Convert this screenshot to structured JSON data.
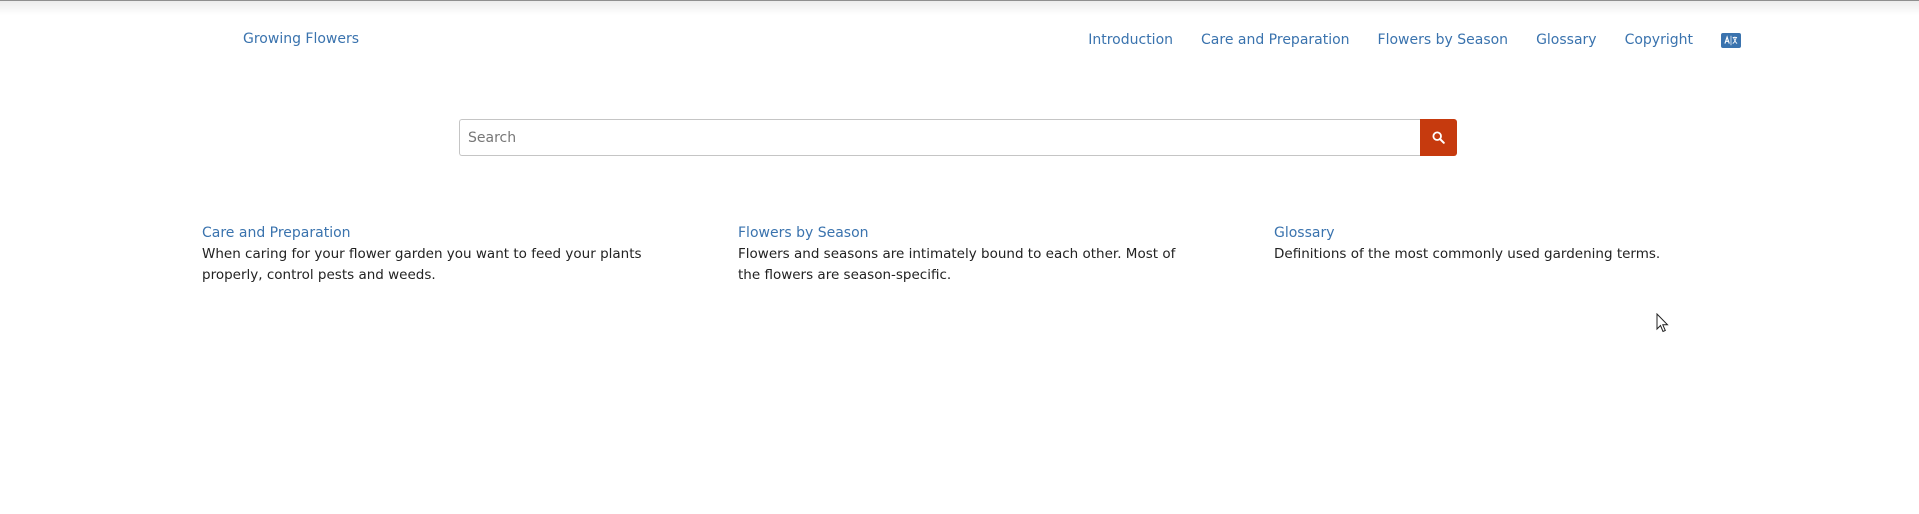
{
  "header": {
    "site_title": "Growing Flowers",
    "nav": [
      {
        "label": "Introduction"
      },
      {
        "label": "Care and Preparation"
      },
      {
        "label": "Flowers by Season"
      },
      {
        "label": "Glossary"
      },
      {
        "label": "Copyright"
      }
    ],
    "language_icon": "translate-icon"
  },
  "search": {
    "placeholder": "Search",
    "value": "",
    "button_icon": "search-icon"
  },
  "cards": [
    {
      "title": "Care and Preparation",
      "description": "When caring for your flower garden you want to feed your plants properly, control pests and weeds."
    },
    {
      "title": "Flowers by Season",
      "description": "Flowers and seasons are intimately bound to each other. Most of the flowers are season-specific."
    },
    {
      "title": "Glossary",
      "description": "Definitions of the most commonly used gardening terms."
    }
  ],
  "colors": {
    "link": "#3a73ae",
    "accent": "#c63a0e",
    "text": "#222222"
  }
}
